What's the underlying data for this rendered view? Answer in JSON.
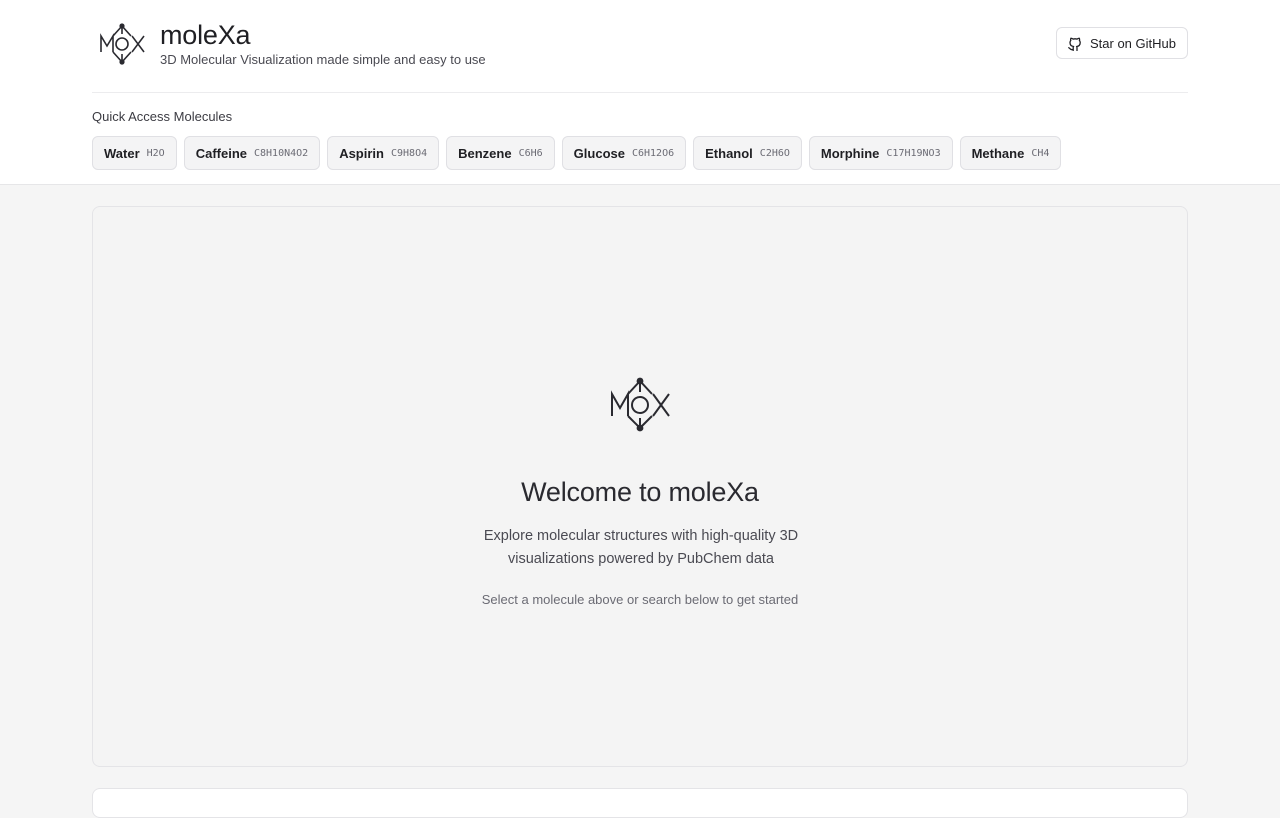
{
  "app": {
    "title": "moleXa",
    "subtitle": "3D Molecular Visualization made simple and easy to use",
    "logo_icon": "molecule-logo-icon"
  },
  "header": {
    "github_label": "Star on GitHub",
    "github_icon": "github-icon"
  },
  "quick_access": {
    "label": "Quick Access Molecules",
    "molecules": [
      {
        "name": "Water",
        "formula": "H2O"
      },
      {
        "name": "Caffeine",
        "formula": "C8H10N4O2"
      },
      {
        "name": "Aspirin",
        "formula": "C9H8O4"
      },
      {
        "name": "Benzene",
        "formula": "C6H6"
      },
      {
        "name": "Glucose",
        "formula": "C6H12O6"
      },
      {
        "name": "Ethanol",
        "formula": "C2H6O"
      },
      {
        "name": "Morphine",
        "formula": "C17H19NO3"
      },
      {
        "name": "Methane",
        "formula": "CH4"
      }
    ]
  },
  "welcome": {
    "title": "Welcome to moleXa",
    "description": "Explore molecular structures with high-quality 3D visualizations powered by PubChem data",
    "hint": "Select a molecule above or search below to get started"
  },
  "colors": {
    "accent": "#1f1f23",
    "background": "#f5f5f5",
    "border": "#e4e4e7"
  }
}
